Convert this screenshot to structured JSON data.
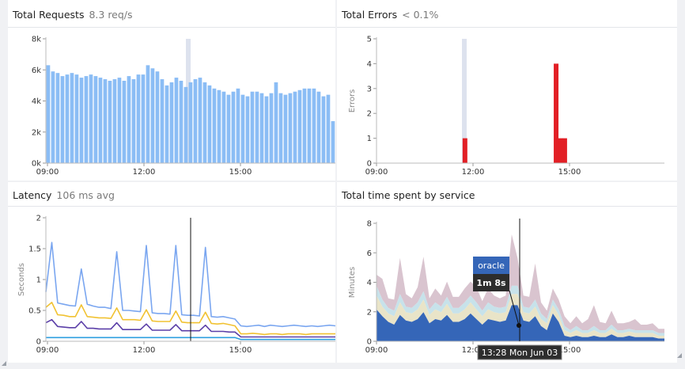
{
  "panels": {
    "requests": {
      "title": "Total Requests",
      "subtitle": "8.3 req/s"
    },
    "errors": {
      "title": "Total Errors",
      "subtitle": "< 0.1%"
    },
    "latency": {
      "title": "Latency",
      "subtitle": "106 ms avg"
    },
    "time_by_service": {
      "title": "Total time spent by service"
    }
  },
  "tooltip": {
    "service": "oracle",
    "value": "1m 8s",
    "timestamp": "13:28 Mon Jun 03"
  },
  "colors": {
    "requests_bar": "#8bbdf5",
    "hover_band": "#dde2ee",
    "errors_bar": "#e21f25",
    "latency_p99": "#7aa6f0",
    "latency_p90": "#f1c232",
    "latency_p75": "#5b3fa8",
    "latency_p50": "#2e9fe0",
    "oracle_area": "#3566b8",
    "stack_layer_2": "#e9e4c8",
    "stack_layer_3": "#c7e2ea",
    "stack_layer_4": "#d9c4cf"
  },
  "chart_data": [
    {
      "id": "requests",
      "type": "bar",
      "title": "Total Requests",
      "ylabel": "",
      "x_ticks": [
        "09:00",
        "12:00",
        "15:00"
      ],
      "y_ticks": [
        "0k",
        "2k",
        "4k",
        "6k",
        "8k"
      ],
      "ylim": [
        0,
        8000
      ],
      "values": [
        6300,
        5900,
        5800,
        5600,
        5700,
        5800,
        5700,
        5500,
        5600,
        5700,
        5600,
        5500,
        5400,
        5300,
        5400,
        5500,
        5300,
        5600,
        5400,
        5700,
        5700,
        6300,
        6100,
        5900,
        5400,
        5000,
        5200,
        5500,
        5300,
        4900,
        5200,
        5400,
        5500,
        5200,
        5000,
        4800,
        4700,
        4600,
        4400,
        4600,
        4800,
        4400,
        4300,
        4600,
        4600,
        4500,
        4300,
        4500,
        5200,
        4500,
        4400,
        4500,
        4600,
        4700,
        4800,
        4800,
        4800,
        4600,
        4300,
        4400,
        2700
      ]
    },
    {
      "id": "errors",
      "type": "bar",
      "title": "Total Errors",
      "ylabel": "Errors",
      "x_ticks": [
        "09:00",
        "12:00",
        "15:00"
      ],
      "y_ticks": [
        "0",
        "1",
        "2",
        "3",
        "4",
        "5"
      ],
      "ylim": [
        0,
        5
      ],
      "bars": [
        {
          "time": "11:45",
          "value": 1
        },
        {
          "time": "14:35",
          "value": 4
        },
        {
          "time": "14:43",
          "value": 1
        },
        {
          "time": "14:51",
          "value": 1
        }
      ]
    },
    {
      "id": "latency",
      "type": "line",
      "title": "Latency",
      "ylabel": "Seconds",
      "x_ticks": [
        "09:00",
        "12:00",
        "15:00"
      ],
      "y_ticks": [
        "0",
        "0.5",
        "1",
        "1.5",
        "2"
      ],
      "ylim": [
        0,
        2
      ],
      "spike_values": [
        1.6,
        1.17,
        1.45,
        1.55,
        1.55,
        1.52
      ],
      "series": [
        {
          "name": "",
          "color": "#7aa6f0",
          "values": [
            0.8,
            0.65,
            0.62,
            0.6,
            0.58,
            0.57,
            0.58,
            0.6,
            0.57,
            0.55,
            0.55,
            0.53,
            0.52,
            0.5,
            0.5,
            0.49,
            0.48,
            0.47,
            0.46,
            0.45,
            0.45,
            0.44,
            0.45,
            0.43,
            0.42,
            0.42,
            0.41,
            0.4,
            0.4,
            0.39,
            0.4,
            0.38,
            0.36,
            0.25,
            0.24,
            0.25,
            0.26,
            0.24,
            0.26,
            0.25,
            0.24,
            0.25,
            0.26,
            0.25,
            0.24,
            0.25,
            0.24,
            0.25,
            0.26,
            0.25
          ]
        },
        {
          "name": "",
          "color": "#f1c232",
          "values": [
            0.55,
            0.45,
            0.43,
            0.42,
            0.4,
            0.4,
            0.41,
            0.4,
            0.39,
            0.38,
            0.38,
            0.37,
            0.36,
            0.35,
            0.35,
            0.35,
            0.34,
            0.33,
            0.33,
            0.32,
            0.32,
            0.32,
            0.31,
            0.31,
            0.3,
            0.3,
            0.3,
            0.29,
            0.29,
            0.28,
            0.29,
            0.27,
            0.25,
            0.12,
            0.12,
            0.13,
            0.12,
            0.11,
            0.12,
            0.12,
            0.11,
            0.12,
            0.12,
            0.12,
            0.11,
            0.12,
            0.12,
            0.12,
            0.12,
            0.12
          ]
        },
        {
          "name": "",
          "color": "#5b3fa8",
          "values": [
            0.3,
            0.25,
            0.24,
            0.23,
            0.22,
            0.22,
            0.22,
            0.21,
            0.21,
            0.2,
            0.2,
            0.2,
            0.2,
            0.19,
            0.19,
            0.19,
            0.19,
            0.18,
            0.18,
            0.18,
            0.18,
            0.18,
            0.17,
            0.17,
            0.17,
            0.17,
            0.17,
            0.16,
            0.16,
            0.16,
            0.16,
            0.15,
            0.15,
            0.07,
            0.07,
            0.07,
            0.07,
            0.07,
            0.07,
            0.07,
            0.07,
            0.07,
            0.07,
            0.07,
            0.07,
            0.07,
            0.07,
            0.07,
            0.07,
            0.07
          ]
        },
        {
          "name": "",
          "color": "#2e9fe0",
          "values": [
            0.06,
            0.06,
            0.06,
            0.06,
            0.06,
            0.06,
            0.06,
            0.06,
            0.06,
            0.06,
            0.06,
            0.06,
            0.06,
            0.06,
            0.06,
            0.06,
            0.06,
            0.06,
            0.06,
            0.06,
            0.06,
            0.06,
            0.06,
            0.06,
            0.06,
            0.06,
            0.06,
            0.06,
            0.06,
            0.06,
            0.06,
            0.06,
            0.06,
            0.03,
            0.03,
            0.03,
            0.03,
            0.03,
            0.03,
            0.03,
            0.03,
            0.03,
            0.03,
            0.03,
            0.03,
            0.03,
            0.03,
            0.03,
            0.03,
            0.03
          ]
        }
      ]
    },
    {
      "id": "time_by_service",
      "type": "area",
      "title": "Total time spent by service",
      "ylabel": "Minutes",
      "x_ticks": [
        "09:00",
        "12:00",
        "15:00"
      ],
      "y_ticks": [
        "0",
        "2",
        "4",
        "6",
        "8"
      ],
      "ylim": [
        0,
        8.5
      ],
      "series": [
        {
          "name": "oracle",
          "values": [
            2.3,
            1.8,
            1.4,
            1.2,
            1.9,
            1.5,
            1.4,
            1.6,
            2.1,
            1.3,
            1.6,
            1.5,
            1.9,
            1.4,
            1.4,
            1.6,
            2.0,
            1.6,
            1.2,
            1.6,
            1.5,
            1.4,
            1.5,
            2.6,
            2.6,
            1.5,
            1.4,
            1.8,
            1.1,
            0.8,
            2.0,
            1.4,
            0.4,
            0.3,
            0.4,
            0.3,
            0.3,
            0.4,
            0.3,
            0.3,
            0.5,
            0.3,
            0.3,
            0.4,
            0.3,
            0.3,
            0.3,
            0.3,
            0.2,
            0.2
          ]
        },
        {
          "name": "",
          "values": [
            1.0,
            0.7,
            0.6,
            0.6,
            0.9,
            0.6,
            0.6,
            0.7,
            0.9,
            0.6,
            0.7,
            0.6,
            0.8,
            0.6,
            0.6,
            0.7,
            0.8,
            0.7,
            0.6,
            0.7,
            0.6,
            0.6,
            0.6,
            0.8,
            0.8,
            0.6,
            0.6,
            0.7,
            0.5,
            0.5,
            0.6,
            0.5,
            0.4,
            0.3,
            0.4,
            0.3,
            0.3,
            0.4,
            0.3,
            0.3,
            0.4,
            0.3,
            0.3,
            0.3,
            0.3,
            0.3,
            0.3,
            0.3,
            0.2,
            0.2
          ]
        },
        {
          "name": "",
          "values": [
            0.7,
            0.5,
            0.4,
            0.4,
            0.6,
            0.4,
            0.4,
            0.5,
            0.6,
            0.4,
            0.5,
            0.4,
            0.5,
            0.4,
            0.4,
            0.5,
            0.5,
            0.5,
            0.4,
            0.5,
            0.4,
            0.4,
            0.4,
            0.6,
            0.6,
            0.4,
            0.4,
            0.5,
            0.4,
            0.3,
            0.4,
            0.4,
            0.3,
            0.2,
            0.3,
            0.2,
            0.2,
            0.3,
            0.2,
            0.2,
            0.3,
            0.2,
            0.2,
            0.2,
            0.2,
            0.2,
            0.2,
            0.2,
            0.2,
            0.2
          ]
        },
        {
          "name": "",
          "values": [
            0.8,
            1.5,
            0.7,
            0.8,
            2.6,
            0.9,
            0.7,
            1.1,
            2.5,
            0.8,
            1.0,
            0.8,
            1.1,
            0.8,
            0.8,
            1.0,
            1.0,
            1.1,
            0.7,
            1.0,
            0.8,
            0.7,
            0.8,
            3.7,
            2.0,
            0.8,
            0.8,
            2.6,
            0.8,
            0.6,
            0.8,
            0.7,
            0.7,
            0.5,
            0.7,
            0.5,
            0.8,
            1.5,
            0.6,
            0.5,
            1.0,
            0.5,
            0.5,
            0.5,
            0.8,
            0.4,
            0.4,
            0.5,
            0.3,
            0.3
          ]
        }
      ]
    }
  ]
}
